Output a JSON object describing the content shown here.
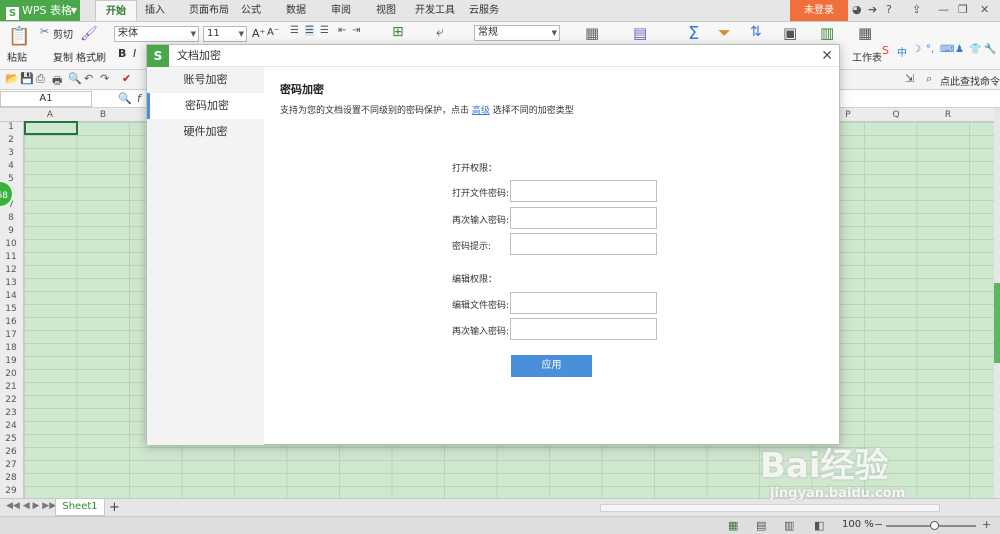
{
  "app": {
    "name": "WPS 表格"
  },
  "tabs": [
    {
      "label": "开始",
      "active": true
    },
    {
      "label": "插入"
    },
    {
      "label": "页面布局"
    },
    {
      "label": "公式"
    },
    {
      "label": "数据"
    },
    {
      "label": "审阅"
    },
    {
      "label": "视图"
    },
    {
      "label": "开发工具"
    },
    {
      "label": "云服务"
    }
  ],
  "login_label": "未登录",
  "ribbon": {
    "paste": "粘贴",
    "cut": "剪切",
    "copy": "复制",
    "format_painter": "格式刷",
    "font_name": "宋体",
    "font_size": "11",
    "number_format": "常规",
    "worksheet": "工作表",
    "bold": "B",
    "italic": "I"
  },
  "search_command": "点此查找命令",
  "formula_bar": {
    "name_box": "A1"
  },
  "grid": {
    "columns_left": [
      "A",
      "B"
    ],
    "columns_right": [
      "P",
      "Q",
      "R"
    ],
    "rows": [
      "1",
      "2",
      "3",
      "4",
      "5",
      "6",
      "7",
      "8",
      "9",
      "10",
      "11",
      "12",
      "13",
      "14",
      "15",
      "16",
      "17",
      "18",
      "19",
      "20",
      "21",
      "22",
      "23",
      "24",
      "25",
      "26",
      "27",
      "28",
      "29"
    ]
  },
  "badge_text": "68",
  "sheet_tab": "Sheet1",
  "status": {
    "zoom": "100 %"
  },
  "dialog": {
    "title": "文档加密",
    "sidebar": [
      {
        "label": "账号加密"
      },
      {
        "label": "密码加密",
        "active": true
      },
      {
        "label": "硬件加密"
      }
    ],
    "heading": "密码加密",
    "desc_before": "支持为您的文档设置不同级别的密码保护，点击 ",
    "desc_link": "高级",
    "desc_after": " 选择不同的加密类型",
    "open_section": "打开权限：",
    "open_password_label": "打开文件密码:",
    "open_confirm_label": "再次输入密码:",
    "hint_label": "密码提示:",
    "edit_section": "编辑权限：",
    "edit_password_label": "编辑文件密码:",
    "edit_confirm_label": "再次输入密码:",
    "apply_label": "应用"
  },
  "watermark": {
    "brand": "Bai经验",
    "url": "jingyan.baidu.com"
  },
  "colors": {
    "accent_green": "#4aa84a",
    "login_orange": "#f0703c",
    "apply_blue": "#4a8fd9",
    "grid_green": "#cfe6cf"
  }
}
